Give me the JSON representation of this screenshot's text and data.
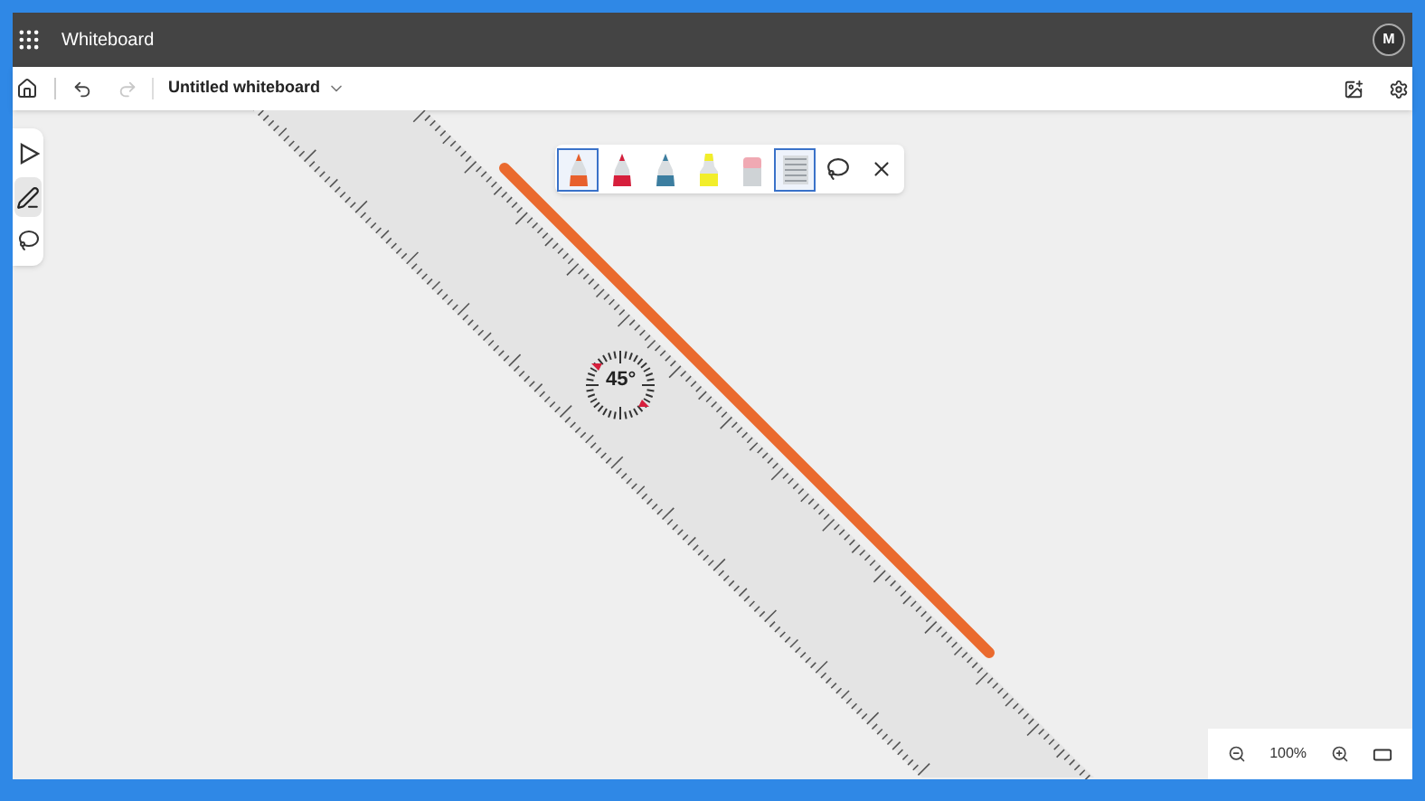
{
  "app": {
    "title": "Whiteboard",
    "avatar": "M"
  },
  "toolbar": {
    "file_name": "Untitled whiteboard",
    "redo_disabled": true
  },
  "side_tools": [
    {
      "kind": "select",
      "selected": false
    },
    {
      "kind": "pen",
      "selected": true
    },
    {
      "kind": "lasso",
      "selected": false
    }
  ],
  "pen_tray": [
    {
      "kind": "pen",
      "color": "#e8602c",
      "selected": true
    },
    {
      "kind": "pen",
      "color": "#d61f3c",
      "selected": false
    },
    {
      "kind": "pen",
      "color": "#3c7ea0",
      "selected": false
    },
    {
      "kind": "highlighter",
      "color": "#f2ee2a",
      "selected": false
    },
    {
      "kind": "eraser",
      "color": "#f0a9b3",
      "selected": false
    },
    {
      "kind": "ruler",
      "selected": true
    },
    {
      "kind": "lasso",
      "selected": false
    },
    {
      "kind": "close",
      "selected": false
    }
  ],
  "ruler": {
    "angle": "45°"
  },
  "zoom": {
    "value": "100%"
  }
}
